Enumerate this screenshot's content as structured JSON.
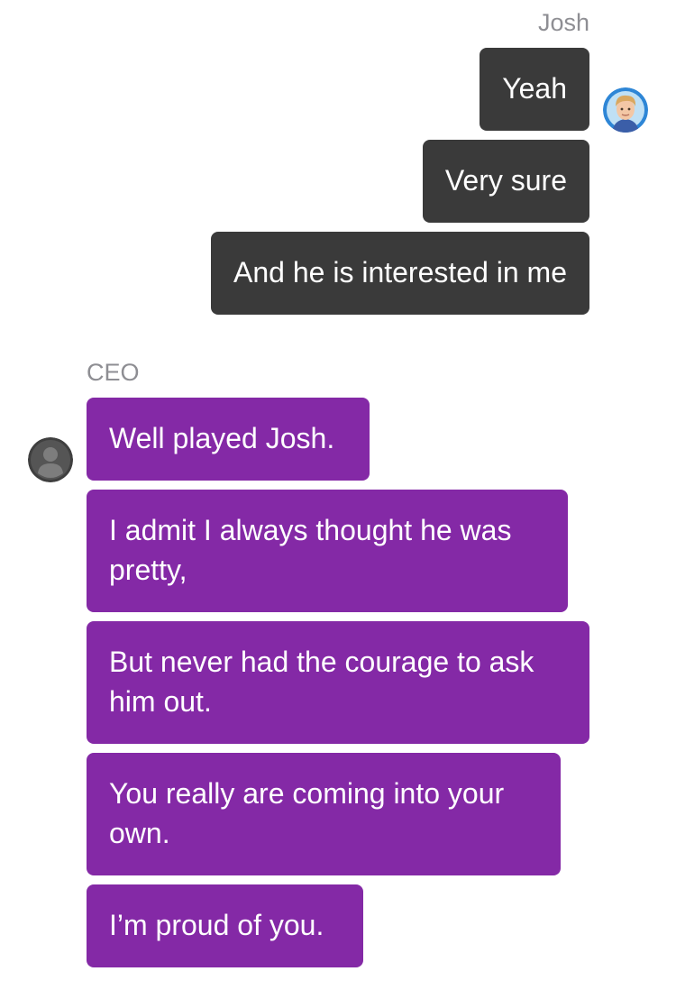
{
  "conversation": {
    "josh": {
      "name": "Josh",
      "avatar_icon": "cartoon-man-avatar-icon",
      "messages": [
        "Yeah",
        "Very sure",
        "And he is interested in me"
      ]
    },
    "ceo": {
      "name": "CEO",
      "avatar_icon": "default-person-avatar-icon",
      "messages": [
        "Well played Josh.",
        "I admit I always thought he was pretty,",
        "But never had the courage to ask him out.",
        "You really are coming into your own.",
        "I’m proud of you."
      ]
    }
  },
  "colors": {
    "josh_bubble": "#3a3a3a",
    "ceo_bubble": "#8429a6",
    "sender_name": "#8e8e93",
    "bubble_text": "#ffffff",
    "background": "#ffffff"
  }
}
